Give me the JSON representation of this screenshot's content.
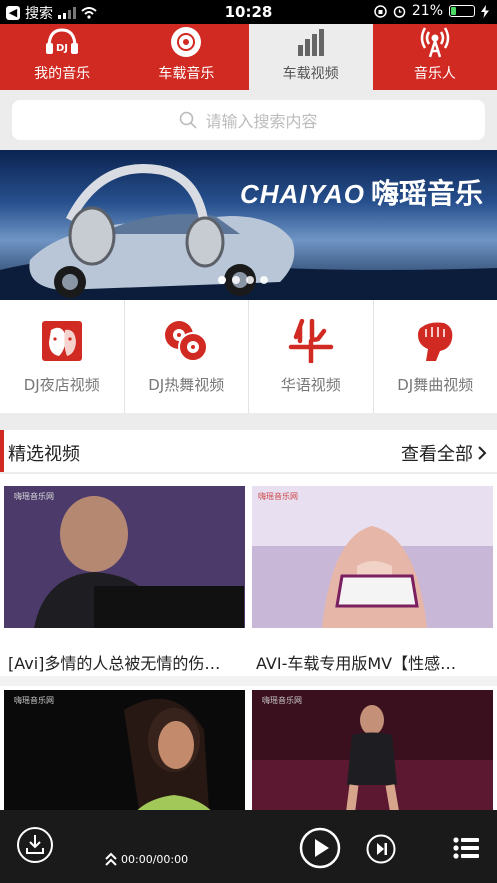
{
  "status_bar": {
    "back_label": "搜索",
    "time": "10:28",
    "battery": "21%",
    "battery_level": 0.21
  },
  "tabs": [
    {
      "label": "我的音乐",
      "icon": "dj-headphones-icon",
      "active": false
    },
    {
      "label": "车载音乐",
      "icon": "disc-icon",
      "active": false
    },
    {
      "label": "车载视频",
      "icon": "bar-chart-icon",
      "active": true
    },
    {
      "label": "音乐人",
      "icon": "broadcast-icon",
      "active": false
    }
  ],
  "search": {
    "placeholder": "请输入搜索内容",
    "icon": "search-icon"
  },
  "banner": {
    "brand_latin": "CHAIYAO",
    "brand_cn": "嗨瑶音乐",
    "active_dot": 0,
    "dot_count": 4
  },
  "categories": [
    {
      "label": "DJ夜店视频",
      "icon": "faces-icon"
    },
    {
      "label": "DJ热舞视频",
      "icon": "discs-icon"
    },
    {
      "label": "华语视频",
      "icon": "hua-character-icon"
    },
    {
      "label": "DJ舞曲视频",
      "icon": "fist-icon"
    }
  ],
  "section": {
    "title": "精选视频",
    "more_label": "查看全部"
  },
  "videos": [
    {
      "title": "[Avi]多情的人总被无情的伤…"
    },
    {
      "title": "AVI-车载专用版MV【性感…"
    },
    {
      "title": ""
    },
    {
      "title": ""
    }
  ],
  "player": {
    "time": "00:00/00:00"
  },
  "colors": {
    "brand_red": "#d12a22",
    "player_bg": "#1a1a1a",
    "page_bg": "#ececec"
  }
}
